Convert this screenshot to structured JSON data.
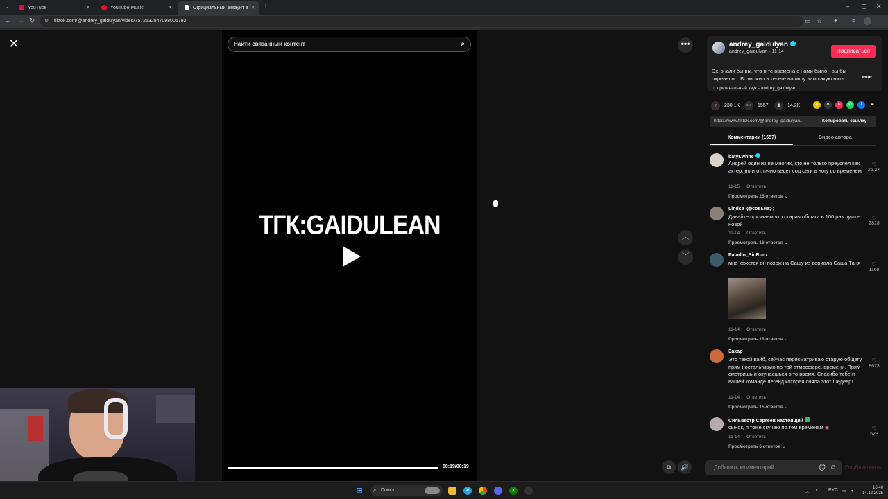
{
  "browser": {
    "tabs": [
      {
        "label": "YouTube",
        "favicon_color": "#ff0033"
      },
      {
        "label": "YouTube Music",
        "favicon_color": "#ff0033"
      },
      {
        "label": "Официальный аккаунт andrey",
        "favicon_color": "#ffffff"
      }
    ],
    "url": "tiktok.com/@andrey_gaidulyan/video/7572532847098006792"
  },
  "video": {
    "search_placeholder": "Найти связанный контент",
    "title_overlay": "ТГК:GAIDULEAN",
    "timecode": "00:19/00:19",
    "progress": 1.0
  },
  "author": {
    "name": "andrey_gaidulyan",
    "handle_date": "andrey_gaidulyan · 11-14",
    "subscribe_label": "Подписаться",
    "description": "Эх, знали бы вы, что в те времена с нами было - вы бы охренели... Возможно в телеге напишу вам какую нить...",
    "more_label": "еще",
    "sound": "♫ оригинальный звук - andrey_gaidulyan"
  },
  "stats": {
    "likes": "230.1K",
    "comments": "1557",
    "saves": "14.2K"
  },
  "share": {
    "link": "https://www.tiktok.com/@andrey_gaidulyan...",
    "copy_label": "Копировать ссылку"
  },
  "panel_tabs": {
    "comments": "Комментарии (1557)",
    "author_videos": "Видео автора"
  },
  "comments": [
    {
      "user": "batyr.white",
      "text": "Андрей один из не многих, кто не только преуспел как актер, но и отлично ведет соц сети в ногу со временем",
      "date": "11-15",
      "reply": "Ответить",
      "likes": "25.2K",
      "replies": "Просмотреть 25 ответов ⌄",
      "avatar_color": "#d8d2c8"
    },
    {
      "user": "Lindsa қфсовьна;-;",
      "text": "Давайте признаем что старая общага в 100 раз лучше новой",
      "date": "11-14",
      "reply": "Ответить",
      "likes": "2818",
      "replies": "Просмотреть 16 ответов ⌄",
      "avatar_color": "#8a7f74"
    },
    {
      "user": "Paladin_SinRunx",
      "text": "мне кажется он похож на Сашу из сериала Саша Таня",
      "date": "11-14",
      "reply": "Ответить",
      "likes": "1168",
      "replies": "Просмотреть 18 ответов ⌄",
      "avatar_color": "#3c5a6a"
    },
    {
      "user": "Захар",
      "text": "Это такой вайб, сейчас пересматриваю старую общагу, прям ностальгирую по той атмосфере, времени. Прям смотришь и окунаешься в то время. Спасибо тебе и вашей команде легенд которая сняла этот шедевр!",
      "date": "11-14",
      "reply": "Ответить",
      "likes": "8673",
      "replies": "Просмотреть 15 ответов ⌄",
      "avatar_color": "#c86a3a"
    },
    {
      "user": "Сильвестр Сергеев настоящий",
      "text": "сынок, я тоже скучаю по тем временам",
      "date": "11-14",
      "reply": "Ответить",
      "likes": "523",
      "replies": "Просмотреть 6 ответов ⌄",
      "avatar_color": "#b8a8b0"
    }
  ],
  "comment_input": {
    "placeholder": "Добавить комментарий...",
    "publish_label": "Опубликовать"
  },
  "taskbar": {
    "search_label": "Поиск",
    "lang": "РУС",
    "time": "16:40",
    "date": "14.12.2025"
  }
}
